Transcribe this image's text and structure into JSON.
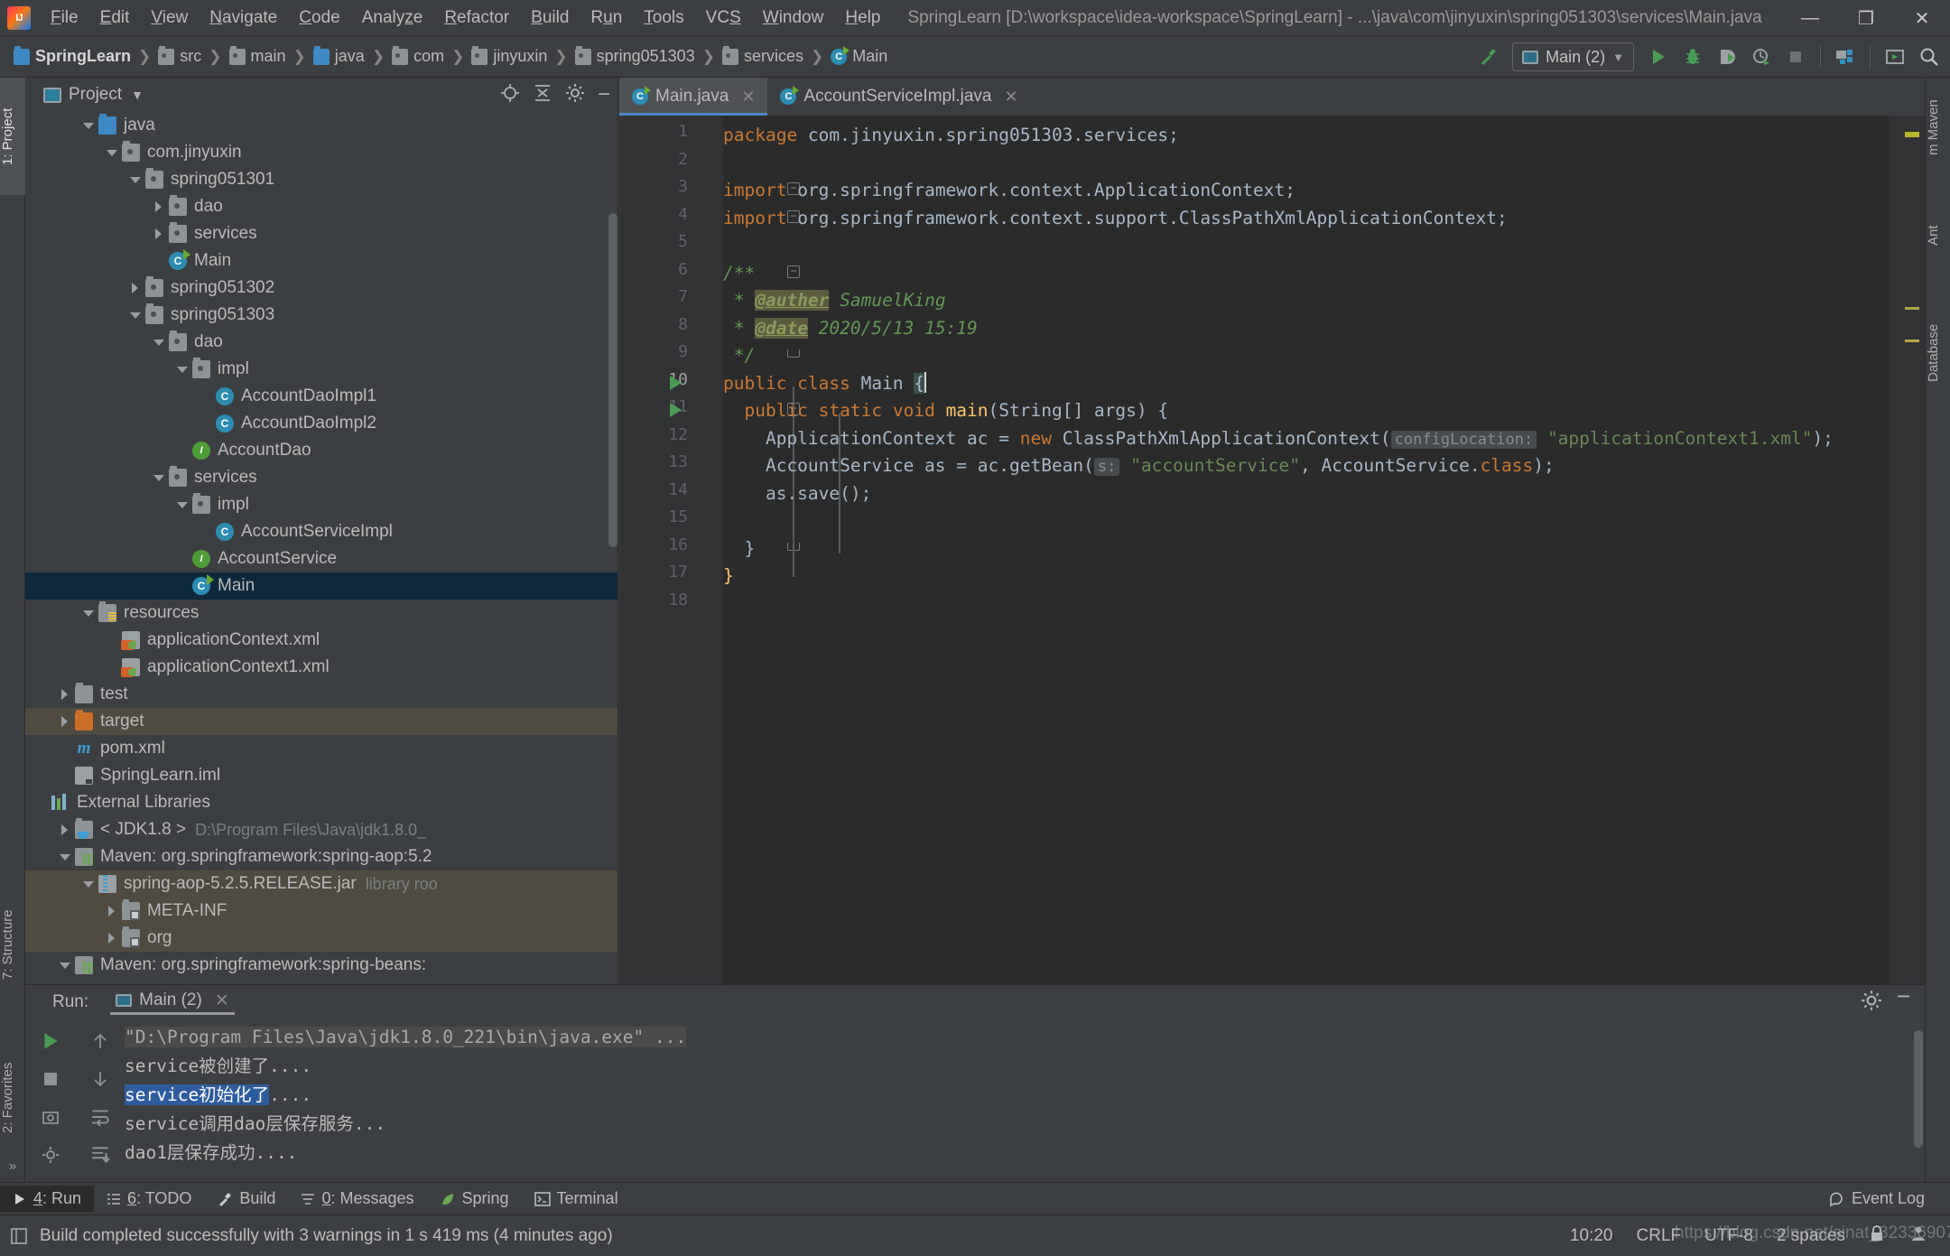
{
  "window": {
    "title": "SpringLearn [D:\\workspace\\idea-workspace\\SpringLearn] - ...\\java\\com\\jinyuxin\\spring051303\\services\\Main.java",
    "minimize": "—",
    "maximize": "❐",
    "close": "✕"
  },
  "menu": [
    {
      "label": "File"
    },
    {
      "label": "Edit"
    },
    {
      "label": "View"
    },
    {
      "label": "Navigate"
    },
    {
      "label": "Code"
    },
    {
      "label": "Analyze"
    },
    {
      "label": "Refactor"
    },
    {
      "label": "Build"
    },
    {
      "label": "Run"
    },
    {
      "label": "Tools"
    },
    {
      "label": "VCS"
    },
    {
      "label": "Window"
    },
    {
      "label": "Help"
    }
  ],
  "breadcrumbs": [
    {
      "label": "SpringLearn",
      "icon": "module-icon"
    },
    {
      "label": "src",
      "icon": "folder-icon"
    },
    {
      "label": "main",
      "icon": "folder-icon"
    },
    {
      "label": "java",
      "icon": "source-folder-icon"
    },
    {
      "label": "com",
      "icon": "package-icon"
    },
    {
      "label": "jinyuxin",
      "icon": "package-icon"
    },
    {
      "label": "spring051303",
      "icon": "package-icon"
    },
    {
      "label": "services",
      "icon": "package-icon"
    },
    {
      "label": "Main",
      "icon": "java-class-icon"
    }
  ],
  "toolbar": {
    "run_config": "Main (2)",
    "build_icon": "hammer-icon",
    "run_icon": "run-icon",
    "debug_icon": "debug-icon",
    "run_coverage_icon": "run-with-coverage-icon",
    "profiler_icon": "profiler-icon",
    "stop_icon": "stop-icon",
    "project_structure_icon": "project-structure-icon",
    "updates_icon": "updates-icon",
    "search_icon": "search-everywhere-icon"
  },
  "left_strip": [
    {
      "label": "1: Project",
      "selected": true
    },
    {
      "label": "7: Structure",
      "selected": false
    },
    {
      "label": "2: Favorites",
      "selected": false
    }
  ],
  "right_strip": [
    {
      "label": "m Maven"
    },
    {
      "label": "Ant"
    },
    {
      "label": "Database"
    }
  ],
  "project_panel": {
    "title": "Project",
    "dropdown_icon": "chevron-down-icon",
    "locate_icon": "scroll-from-source-icon",
    "collapse_icon": "collapse-all-icon",
    "settings_icon": "gear-icon",
    "hide_icon": "hide-icon",
    "tree": [
      {
        "label": "java",
        "indent": 2,
        "arrow": "down",
        "icon": "source-folder-icon"
      },
      {
        "label": "com.jinyuxin",
        "indent": 3,
        "arrow": "down",
        "icon": "package-icon"
      },
      {
        "label": "spring051301",
        "indent": 4,
        "arrow": "down",
        "icon": "package-icon"
      },
      {
        "label": "dao",
        "indent": 5,
        "arrow": "right",
        "icon": "package-icon"
      },
      {
        "label": "services",
        "indent": 5,
        "arrow": "right",
        "icon": "package-icon"
      },
      {
        "label": "Main",
        "indent": 5,
        "arrow": "none",
        "icon": "java-class-runnable-icon"
      },
      {
        "label": "spring051302",
        "indent": 4,
        "arrow": "right",
        "icon": "package-icon"
      },
      {
        "label": "spring051303",
        "indent": 4,
        "arrow": "down",
        "icon": "package-icon"
      },
      {
        "label": "dao",
        "indent": 5,
        "arrow": "down",
        "icon": "package-icon"
      },
      {
        "label": "impl",
        "indent": 6,
        "arrow": "down",
        "icon": "package-icon"
      },
      {
        "label": "AccountDaoImpl1",
        "indent": 7,
        "arrow": "none",
        "icon": "java-class-icon"
      },
      {
        "label": "AccountDaoImpl2",
        "indent": 7,
        "arrow": "none",
        "icon": "java-class-icon"
      },
      {
        "label": "AccountDao",
        "indent": 6,
        "arrow": "none",
        "icon": "java-interface-icon"
      },
      {
        "label": "services",
        "indent": 5,
        "arrow": "down",
        "icon": "package-icon"
      },
      {
        "label": "impl",
        "indent": 6,
        "arrow": "down",
        "icon": "package-icon"
      },
      {
        "label": "AccountServiceImpl",
        "indent": 7,
        "arrow": "none",
        "icon": "java-class-icon"
      },
      {
        "label": "AccountService",
        "indent": 6,
        "arrow": "none",
        "icon": "java-interface-icon"
      },
      {
        "label": "Main",
        "indent": 6,
        "arrow": "none",
        "icon": "java-class-runnable-icon",
        "selected": true
      },
      {
        "label": "resources",
        "indent": 2,
        "arrow": "down",
        "icon": "resources-folder-icon"
      },
      {
        "label": "applicationContext.xml",
        "indent": 3,
        "arrow": "none",
        "icon": "spring-xml-icon"
      },
      {
        "label": "applicationContext1.xml",
        "indent": 3,
        "arrow": "none",
        "icon": "spring-xml-icon"
      },
      {
        "label": "test",
        "indent": 1,
        "arrow": "right",
        "icon": "folder-icon"
      },
      {
        "label": "target",
        "indent": 1,
        "arrow": "right",
        "icon": "excluded-folder-icon",
        "modified": true
      },
      {
        "label": "pom.xml",
        "indent": 1,
        "arrow": "none",
        "icon": "maven-pom-icon"
      },
      {
        "label": "SpringLearn.iml",
        "indent": 1,
        "arrow": "none",
        "icon": "iml-icon"
      },
      {
        "label": "External Libraries",
        "indent": 0,
        "arrow": "none",
        "icon": "libraries-icon"
      },
      {
        "label": "< JDK1.8 >",
        "indent": 1,
        "arrow": "right",
        "icon": "jdk-icon",
        "dim": "D:\\Program Files\\Java\\jdk1.8.0_"
      },
      {
        "label": "Maven: org.springframework:spring-aop:5.2",
        "indent": 1,
        "arrow": "down",
        "icon": "maven-lib-icon"
      },
      {
        "label": "spring-aop-5.2.5.RELEASE.jar",
        "indent": 2,
        "arrow": "down",
        "icon": "jar-icon",
        "dim": "library roo",
        "modified": true
      },
      {
        "label": "META-INF",
        "indent": 3,
        "arrow": "right",
        "icon": "folder-locked-icon",
        "modified": true
      },
      {
        "label": "org",
        "indent": 3,
        "arrow": "right",
        "icon": "folder-locked-icon",
        "modified": true
      },
      {
        "label": "Maven: org.springframework:spring-beans:",
        "indent": 1,
        "arrow": "down",
        "icon": "maven-lib-icon"
      }
    ]
  },
  "editor": {
    "tabs": [
      {
        "label": "Main.java",
        "icon": "java-class-runnable-icon",
        "active": true,
        "close": "✕"
      },
      {
        "label": "AccountServiceImpl.java",
        "icon": "java-class-icon",
        "active": false,
        "close": "✕"
      }
    ],
    "breadcrumb_bottom": "Main",
    "lines": [
      {
        "n": 1,
        "tokens": [
          {
            "t": "package",
            "c": "kw"
          },
          {
            "t": " com.jinyuxin.spring051303.services;",
            "c": "cls"
          }
        ]
      },
      {
        "n": 2,
        "tokens": []
      },
      {
        "n": 3,
        "tokens": [
          {
            "t": "import",
            "c": "kw"
          },
          {
            "t": " org.springframework.context.ApplicationContext;",
            "c": "cls"
          }
        ],
        "fold": "minus"
      },
      {
        "n": 4,
        "tokens": [
          {
            "t": "import",
            "c": "kw"
          },
          {
            "t": " org.springframework.context.support.ClassPathXmlApplicationContext;",
            "c": "cls"
          }
        ],
        "fold": "minus"
      },
      {
        "n": 5,
        "tokens": []
      },
      {
        "n": 6,
        "tokens": [
          {
            "t": "/**",
            "c": "com"
          }
        ],
        "fold": "minus"
      },
      {
        "n": 7,
        "tokens": [
          {
            "t": " * ",
            "c": "com"
          },
          {
            "t": "@auther",
            "c": "tag"
          },
          {
            "t": " SamuelKing",
            "c": "com"
          }
        ]
      },
      {
        "n": 8,
        "tokens": [
          {
            "t": " * ",
            "c": "com"
          },
          {
            "t": "@date",
            "c": "tag"
          },
          {
            "t": " 2020/5/13 15:19",
            "c": "com"
          }
        ]
      },
      {
        "n": 9,
        "tokens": [
          {
            "t": " */",
            "c": "com"
          }
        ],
        "fold": "end"
      },
      {
        "n": 10,
        "tokens": [
          {
            "t": "public class",
            "c": "kw"
          },
          {
            "t": " Main ",
            "c": "cls"
          },
          {
            "t": "{",
            "c": "brace"
          }
        ],
        "runmark": true,
        "current": true
      },
      {
        "n": 11,
        "tokens": [
          {
            "t": "  ",
            "c": "cls"
          },
          {
            "t": "public static void",
            "c": "kw"
          },
          {
            "t": " ",
            "c": "cls"
          },
          {
            "t": "main",
            "c": "mth"
          },
          {
            "t": "(String[] args) {",
            "c": "cls"
          }
        ],
        "runmark": true,
        "fold": "minus"
      },
      {
        "n": 12,
        "tokens": [
          {
            "t": "    ApplicationContext ac = ",
            "c": "cls"
          },
          {
            "t": "new",
            "c": "kw"
          },
          {
            "t": " ClassPathXmlApplicationContext(",
            "c": "cls"
          },
          {
            "t": "configLocation:",
            "c": "hint"
          },
          {
            "t": " ",
            "c": "cls"
          },
          {
            "t": "\"applicationContext1.xml\"",
            "c": "str"
          },
          {
            "t": ");",
            "c": "cls"
          }
        ]
      },
      {
        "n": 13,
        "tokens": [
          {
            "t": "    AccountService as = ac.getBean(",
            "c": "cls"
          },
          {
            "t": "s:",
            "c": "hint"
          },
          {
            "t": " ",
            "c": "cls"
          },
          {
            "t": "\"accountService\"",
            "c": "str"
          },
          {
            "t": ", AccountService.",
            "c": "cls"
          },
          {
            "t": "class",
            "c": "kw"
          },
          {
            "t": ");",
            "c": "cls"
          }
        ]
      },
      {
        "n": 14,
        "tokens": [
          {
            "t": "    as.save();",
            "c": "cls"
          }
        ]
      },
      {
        "n": 15,
        "tokens": []
      },
      {
        "n": 16,
        "tokens": [
          {
            "t": "  }",
            "c": "cls"
          }
        ],
        "fold": "end"
      },
      {
        "n": 17,
        "tokens": [
          {
            "t": "}",
            "c": "brace-y"
          }
        ]
      },
      {
        "n": 18,
        "tokens": []
      }
    ]
  },
  "run_panel": {
    "label": "Run:",
    "tab": "Main (2)",
    "tab_close": "✕",
    "settings_icon": "gear-icon",
    "hide_icon": "hide-icon",
    "side_icons": [
      "rerun-icon",
      "stop-icon",
      "screenshot-icon",
      "settings-icon",
      "up-icon",
      "down-icon",
      "soft-wrap-icon",
      "scroll-to-end-icon"
    ],
    "output": [
      {
        "text": "\"D:\\Program Files\\Java\\jdk1.8.0_221\\bin\\java.exe\" ...",
        "style": "cmd"
      },
      {
        "text": "service被创建了....",
        "style": "normal"
      },
      {
        "text": "service初始化了",
        "style": "highlight",
        "suffix": "...."
      },
      {
        "text": "service调用dao层保存服务...",
        "style": "normal"
      },
      {
        "text": "dao1层保存成功....",
        "style": "normal"
      }
    ]
  },
  "bottom_tabs": [
    {
      "label": "4: Run",
      "key": "4",
      "icon": "run-icon",
      "selected": true
    },
    {
      "label": "6: TODO",
      "key": "6",
      "icon": "todo-icon",
      "selected": false
    },
    {
      "label": "Build",
      "key": "",
      "icon": "build-icon",
      "selected": false
    },
    {
      "label": "0: Messages",
      "key": "0",
      "icon": "messages-icon",
      "selected": false
    },
    {
      "label": "Spring",
      "key": "",
      "icon": "spring-icon",
      "selected": false
    },
    {
      "label": "Terminal",
      "key": "",
      "icon": "terminal-icon",
      "selected": false
    }
  ],
  "bottom_tabs_right": {
    "label": "Event Log",
    "icon": "event-log-icon"
  },
  "statusbar": {
    "message": "Build completed successfully with 3 warnings in 1 s 419 ms (4 minutes ago)",
    "message_icon": "build-status-icon",
    "time": "10:20",
    "line_separator": "CRLF",
    "encoding": "UTF-8",
    "indent": "2 spaces",
    "lock_icon": "lock-icon",
    "branch_icon": "vcs-icon"
  },
  "watermark": "https://blog.csdn.net/sinat_32336907"
}
